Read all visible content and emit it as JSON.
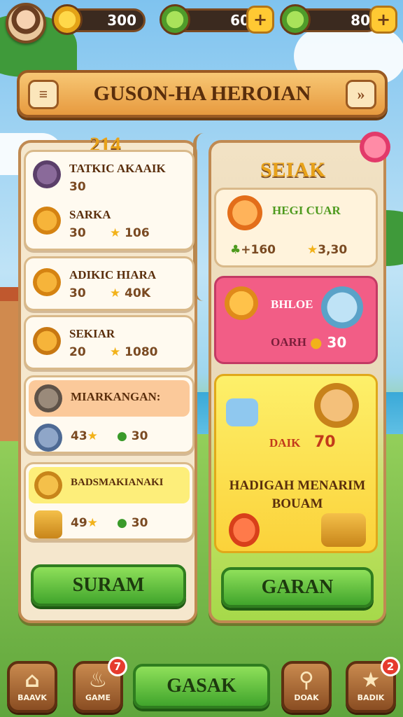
{
  "top_bar": {
    "coins": "300",
    "gems": "60",
    "energy": "80",
    "plus_symbol": "+"
  },
  "title_banner": {
    "title": "GUSON-HA HEROIAN",
    "menu_icon": "menu-icon",
    "forward_icon": "double-chevron-right-icon"
  },
  "left_panel": {
    "score": "214",
    "cards": [
      {
        "name": "TATKIC AKAAIK",
        "value": "30"
      },
      {
        "name": "SARKA",
        "value": "30",
        "stars": "106"
      },
      {
        "name": "ADIKIC HIARA",
        "value": "30",
        "stars": "40K"
      },
      {
        "name": "SEKIAR",
        "value": "20",
        "stars": "1080"
      }
    ],
    "rewards": [
      {
        "title": "MIARKANGAN:",
        "count": "43",
        "coin": "30"
      },
      {
        "title": "BADSMAKIANAKI",
        "count": "49",
        "coin": "30"
      }
    ],
    "button_label": "SURAM"
  },
  "right_panel": {
    "section_title": "SEIAK",
    "hero_name": "HEGI CUAR",
    "hero_gems": "160",
    "hero_stars": "3,30",
    "pink_card": {
      "label": "BHLOE",
      "price_label": "OARH",
      "price": "30"
    },
    "yellow_card": {
      "label": "DAIK",
      "number": "70",
      "promo": "HADIGAH MENARIM BOUAM"
    },
    "button_label": "GARAN"
  },
  "bottom_nav": {
    "items": [
      {
        "label": "BAAVK",
        "icon": "home-icon"
      },
      {
        "label": "GAME",
        "icon": "flame-icon",
        "badge": "7"
      },
      {
        "label": "DOAK",
        "icon": "magnifier-icon"
      },
      {
        "label": "BADIK",
        "icon": "star-icon",
        "badge": "2"
      }
    ],
    "main_button": "GASAK"
  },
  "colors": {
    "accent_orange": "#e79a3f",
    "button_green": "#41a52c",
    "pink_card": "#f25d86",
    "yellow_card": "#fde34a",
    "badge_red": "#e63b2e"
  }
}
